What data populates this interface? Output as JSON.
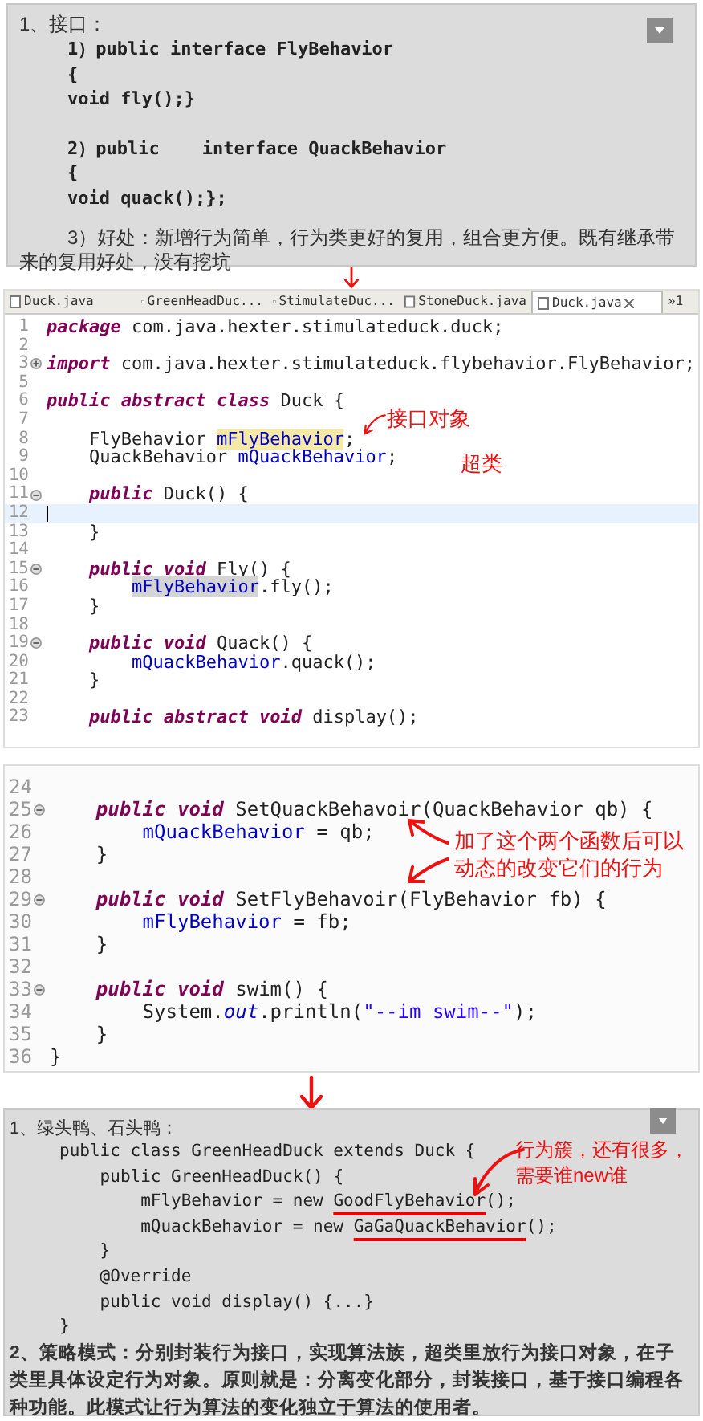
{
  "intro_slide": {
    "heading": "1、接口：",
    "code_blocks": [
      [
        "1）public interface FlyBehavior",
        "{",
        "void fly();}"
      ],
      [
        "2）public    interface QuackBehavior",
        "{",
        "void quack();};"
      ]
    ],
    "note": "3）好处：新增行为简单，行为类更好的复用，组合更方便。既有继承带来的复用好处，没有挖坑"
  },
  "editor": {
    "tabs": [
      {
        "label": "Duck.java",
        "selected": false,
        "closable": false
      },
      {
        "label": "GreenHeadDuc...",
        "selected": false,
        "closable": false
      },
      {
        "label": "StimulateDuc...",
        "selected": false,
        "closable": false
      },
      {
        "label": "StoneDuck.java",
        "selected": false,
        "closable": false
      },
      {
        "label": "Duck.java",
        "selected": true,
        "closable": true
      }
    ],
    "overflow": "»1",
    "lines": [
      {
        "number": "1",
        "tokens": [
          {
            "kind": "keyword",
            "text": "package"
          },
          {
            "kind": "plain",
            "text": " com.java.hexter.stimulateduck.duck;"
          }
        ]
      },
      {
        "number": "2"
      },
      {
        "number": "3",
        "folded": true,
        "tokens": [
          {
            "kind": "keyword",
            "text": "import"
          },
          {
            "kind": "plain",
            "text": " com.java.hexter.stimulateduck.flybehavior.FlyBehavior;"
          }
        ]
      },
      {
        "number": "5"
      },
      {
        "number": "6",
        "tokens": [
          {
            "kind": "keyword",
            "text": "public abstract class"
          },
          {
            "kind": "plain",
            "text": " Duck {"
          }
        ]
      },
      {
        "number": "7"
      },
      {
        "number": "8",
        "tokens": [
          {
            "kind": "plain",
            "text": "    FlyBehavior "
          },
          {
            "kind": "occurrence",
            "text": "mFlyBehavior"
          },
          {
            "kind": "plain",
            "text": ";"
          }
        ]
      },
      {
        "number": "9",
        "tokens": [
          {
            "kind": "plain",
            "text": "    QuackBehavior "
          },
          {
            "kind": "field",
            "text": "mQuackBehavior"
          },
          {
            "kind": "plain",
            "text": ";"
          }
        ]
      },
      {
        "number": "10"
      },
      {
        "number": "11",
        "folded": false,
        "tokens": [
          {
            "kind": "keyword",
            "text": "    public"
          },
          {
            "kind": "plain",
            "text": " Duck() {"
          }
        ]
      },
      {
        "number": "12",
        "current": true
      },
      {
        "number": "13",
        "tokens": [
          {
            "kind": "plain",
            "text": "    }"
          }
        ]
      },
      {
        "number": "14"
      },
      {
        "number": "15",
        "folded": false,
        "tokens": [
          {
            "kind": "keyword",
            "text": "    public void"
          },
          {
            "kind": "plain",
            "text": " Fly() {"
          }
        ]
      },
      {
        "number": "16",
        "tokens": [
          {
            "kind": "selection",
            "text": "        mFlyBehavior"
          },
          {
            "kind": "plain",
            "text": ".fly();"
          }
        ]
      },
      {
        "number": "17",
        "tokens": [
          {
            "kind": "plain",
            "text": "    }"
          }
        ]
      },
      {
        "number": "18"
      },
      {
        "number": "19",
        "folded": false,
        "tokens": [
          {
            "kind": "keyword",
            "text": "    public void"
          },
          {
            "kind": "plain",
            "text": " Quack() {"
          }
        ]
      },
      {
        "number": "20",
        "tokens": [
          {
            "kind": "field",
            "text": "        mQuackBehavior"
          },
          {
            "kind": "plain",
            "text": ".quack();"
          }
        ]
      },
      {
        "number": "21",
        "tokens": [
          {
            "kind": "plain",
            "text": "    }"
          }
        ]
      },
      {
        "number": "22"
      },
      {
        "number": "23",
        "tokens": [
          {
            "kind": "keyword",
            "text": "    public abstract void"
          },
          {
            "kind": "plain",
            "text": " display();"
          }
        ]
      }
    ],
    "annotations": [
      "接口对象",
      "超类"
    ]
  },
  "editor_lower": {
    "lines": [
      {
        "number": "24"
      },
      {
        "number": "25",
        "folded": false,
        "tokens": [
          {
            "kind": "keyword",
            "text": "    public void"
          },
          {
            "kind": "plain",
            "text": " SetQuackBehavoir(QuackBehavior qb) {"
          }
        ]
      },
      {
        "number": "26",
        "tokens": [
          {
            "kind": "field",
            "text": "        mQuackBehavior"
          },
          {
            "kind": "plain",
            "text": " = qb;"
          }
        ]
      },
      {
        "number": "27",
        "tokens": [
          {
            "kind": "plain",
            "text": "    }"
          }
        ]
      },
      {
        "number": "28"
      },
      {
        "number": "29",
        "folded": false,
        "tokens": [
          {
            "kind": "keyword",
            "text": "    public void"
          },
          {
            "kind": "plain",
            "text": " SetFlyBehavoir(FlyBehavior fb) {"
          }
        ]
      },
      {
        "number": "30",
        "tokens": [
          {
            "kind": "field",
            "text": "        mFlyBehavior"
          },
          {
            "kind": "plain",
            "text": " = fb;"
          }
        ]
      },
      {
        "number": "31",
        "tokens": [
          {
            "kind": "plain",
            "text": "    }"
          }
        ]
      },
      {
        "number": "32"
      },
      {
        "number": "33",
        "folded": false,
        "tokens": [
          {
            "kind": "keyword",
            "text": "    public void"
          },
          {
            "kind": "plain",
            "text": " swim() {"
          }
        ]
      },
      {
        "number": "34",
        "tokens": [
          {
            "kind": "plain",
            "text": "        System."
          },
          {
            "kind": "static",
            "text": "out"
          },
          {
            "kind": "plain",
            "text": ".println("
          },
          {
            "kind": "string",
            "text": "\"--im swim--\""
          },
          {
            "kind": "plain",
            "text": ");"
          }
        ]
      },
      {
        "number": "35",
        "tokens": [
          {
            "kind": "plain",
            "text": "    }"
          }
        ]
      },
      {
        "number": "36",
        "tokens": [
          {
            "kind": "plain",
            "text": "}"
          }
        ]
      }
    ],
    "annotation": "加了这个两个函数后可以动态的改变它们的行为"
  },
  "bottom_slide": {
    "heading": "1、绿头鸭、石头鸭：",
    "code_lines": [
      [
        {
          "kind": "plain",
          "text": "public class GreenHeadDuck extends Duck {"
        }
      ],
      [
        {
          "kind": "plain",
          "text": "    public GreenHeadDuck() {"
        }
      ],
      [
        {
          "kind": "plain",
          "text": "        mFlyBehavior = new "
        },
        {
          "kind": "underlined",
          "text": "GoodFlyBehavior"
        },
        {
          "kind": "plain",
          "text": "();"
        }
      ],
      [
        {
          "kind": "plain",
          "text": "        mQuackBehavior = new "
        },
        {
          "kind": "underlined",
          "text": "GaGaQuackBehavior"
        },
        {
          "kind": "plain",
          "text": "();"
        }
      ],
      [
        {
          "kind": "plain",
          "text": "    }"
        }
      ],
      [
        {
          "kind": "plain",
          "text": "    @Override"
        }
      ],
      [
        {
          "kind": "plain",
          "text": "    public void display() {...}"
        }
      ],
      [
        {
          "kind": "plain",
          "text": "}"
        }
      ]
    ],
    "note": "2、策略模式：分别封装行为接口，实现算法族，超类里放行为接口对象，在子类里具体设定行为对象。原则就是：分离变化部分，封装接口，基于接口编程各种功能。此模式让行为算法的变化独立于算法的使用者。",
    "annotation": "行为簇，还有很多，需要谁new谁"
  }
}
